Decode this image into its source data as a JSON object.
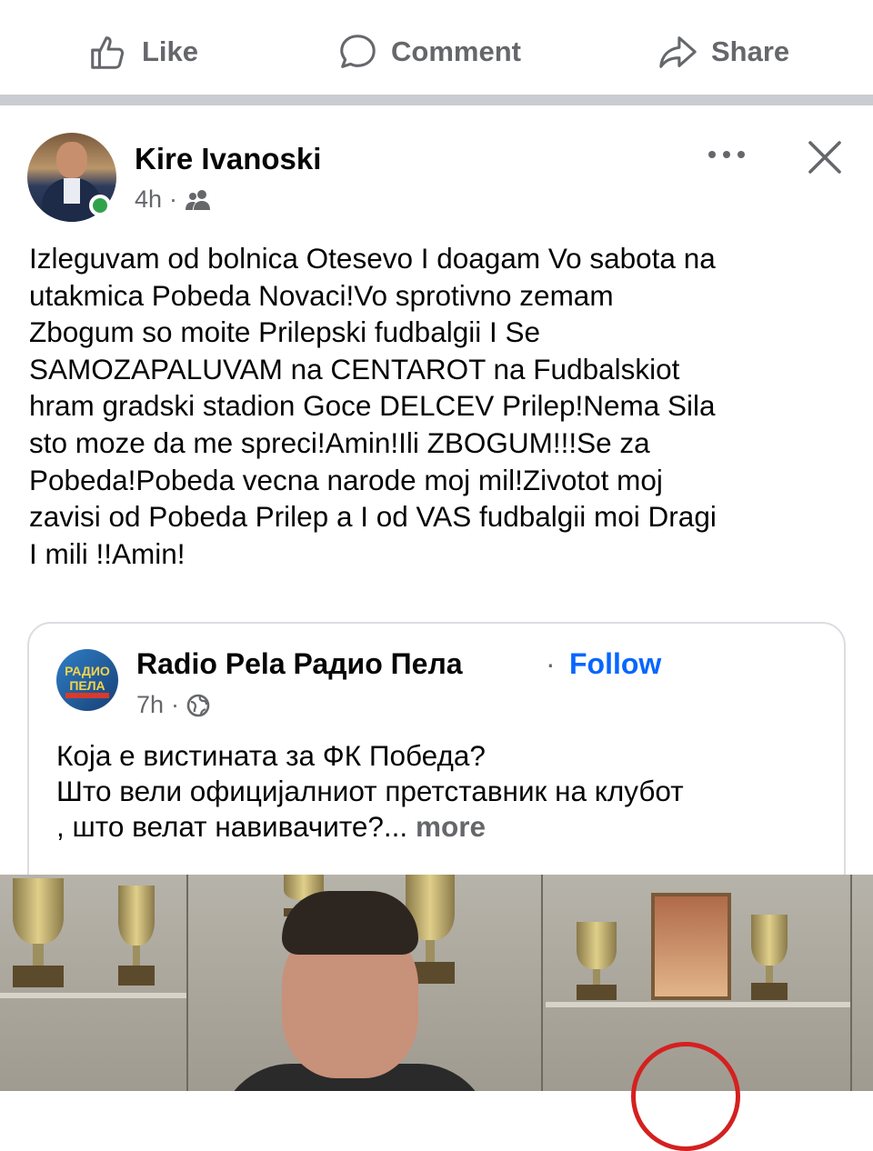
{
  "actions": {
    "like_label": "Like",
    "comment_label": "Comment",
    "share_label": "Share"
  },
  "post": {
    "author_name": "Kire Ivanoski",
    "time": "4h",
    "meta_separator": "·",
    "audience_icon": "friends-icon",
    "more_icon": "more-options-icon",
    "close_icon": "close-icon",
    "online": true,
    "text": "Izleguvam od bolnica Otesevo I doagam Vo sabota na\nutakmica Pobeda Novaci!Vo sprotivno zemam\nZbogum so moite Prilepski fudbalgii I Se\nSAMOZAPALUVAM na CENTAROT na Fudbalskiot\nhram gradski stadion Goce DELCEV Prilep!Nema Sila\nsto moze da me spreci!Amin!Ili ZBOGUM!!!Se za\nPobeda!Pobeda vecna narode moj mil!Zivotot moj\nzavisi od Pobeda Prilep a I od VAS fudbalgii moi Dragi\nI mili !!Amin!"
  },
  "shared": {
    "page_name": "Radio Pela Радио Пела",
    "separator": "·",
    "follow_label": "Follow",
    "time": "7h",
    "meta_separator": "·",
    "audience_icon": "globe-icon",
    "logo_text": "РАДИО ПЕЛА",
    "text": "Која е вистината за ФК Победа?\nШто вели официјалниот претставник на клубот\n, што велат навивачите?...",
    "see_more": "more"
  },
  "colors": {
    "accent": "#0866ff",
    "secondary_text": "#65676b",
    "primary_text": "#050505",
    "online": "#31a24c",
    "divider": "#c9ccd1"
  }
}
